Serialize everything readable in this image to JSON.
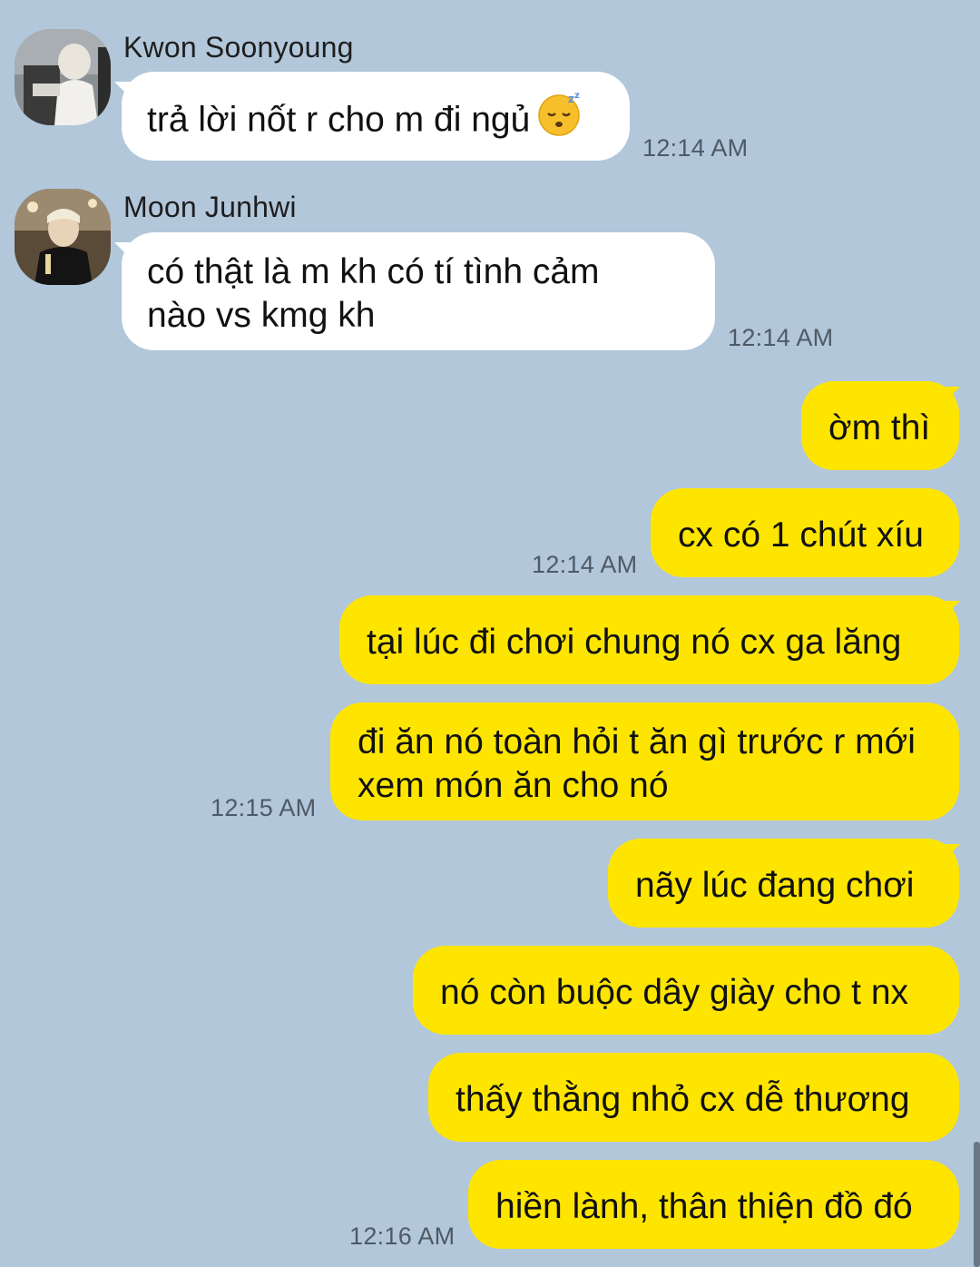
{
  "theme": {
    "background": "#b2c7da",
    "incoming_bubble": "#ffffff",
    "outgoing_bubble": "#fee500"
  },
  "messages_in": [
    {
      "sender": "Kwon Soonyoung",
      "text": "trả lời nốt r cho m đi ngủ",
      "emoji": "sleeping-face-icon",
      "time": "12:14 AM"
    },
    {
      "sender": "Moon Junhwi",
      "line1": "có thật là m kh có tí tình cảm",
      "line2": "nào vs kmg kh",
      "time": "12:14 AM"
    }
  ],
  "messages_out": [
    {
      "text": "ờm thì"
    },
    {
      "text": "cx có 1 chút xíu",
      "time": "12:14 AM"
    },
    {
      "text": "tại lúc đi chơi chung nó cx ga lăng"
    },
    {
      "line1": "đi ăn nó toàn hỏi t ăn gì trước r mới",
      "line2": "xem món ăn cho nó",
      "time": "12:15 AM"
    },
    {
      "text": "nãy lúc đang chơi"
    },
    {
      "text": "nó còn buộc dây giày cho t nx"
    },
    {
      "text": "thấy thằng nhỏ cx dễ thương"
    },
    {
      "text": "hiền lành, thân thiện đồ đó",
      "time": "12:16 AM"
    }
  ]
}
